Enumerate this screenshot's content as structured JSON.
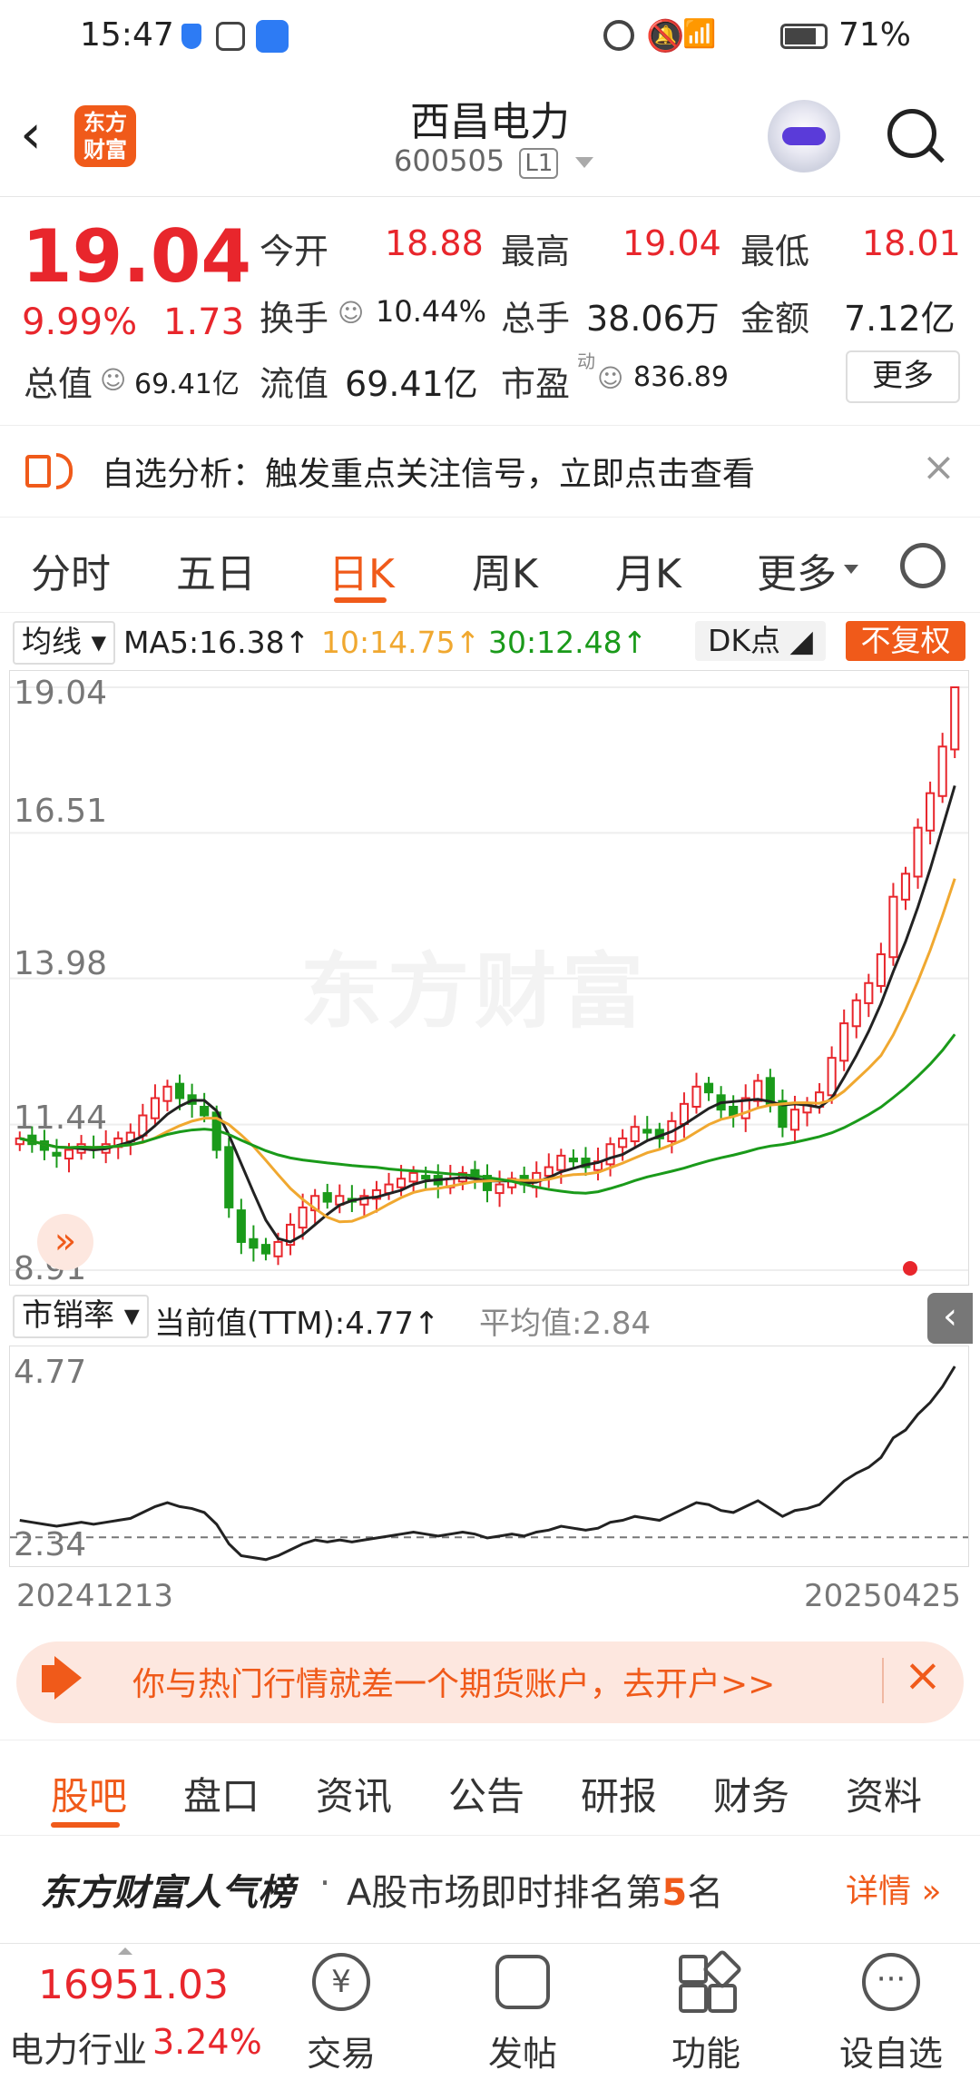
{
  "status_bar": {
    "time": "15:47",
    "battery": "71%"
  },
  "header": {
    "stock_name": "西昌电力",
    "stock_code": "600505",
    "level": "L1",
    "logo_text_1": "东方",
    "logo_text_2": "财富"
  },
  "quote": {
    "price": "19.04",
    "change_pct": "9.99%",
    "change": "1.73",
    "open_label": "今开",
    "open": "18.88",
    "high_label": "最高",
    "high": "19.04",
    "low_label": "最低",
    "low": "18.01",
    "turnover_label": "换手",
    "turnover": "10.44%",
    "volume_label": "总手",
    "volume": "38.06万",
    "amount_label": "金额",
    "amount": "7.12亿",
    "mktcap_label": "总值",
    "mktcap": "69.41亿",
    "float_label": "流值",
    "float": "69.41亿",
    "pe_label": "市盈",
    "pe_sup": "动",
    "pe": "836.89",
    "more_button": "更多"
  },
  "alert": {
    "text": "自选分析：触发重点关注信号，立即点击查看"
  },
  "chart_tabs": [
    "分时",
    "五日",
    "日K",
    "周K",
    "月K",
    "更多"
  ],
  "active_tab_index": 2,
  "ma_bar": {
    "selector": "均线",
    "ma5": "MA5:16.38↑",
    "ma10": "10:14.75↑",
    "ma30": "30:12.48↑",
    "dk": "DK点",
    "fq": "不复权"
  },
  "kline_axis": {
    "ticks": [
      "19.04",
      "16.51",
      "13.98",
      "11.44",
      "8.91"
    ]
  },
  "indicator_bar": {
    "selector": "市销率",
    "current": "当前值(TTM):4.77↑",
    "average": "平均值:2.84"
  },
  "indicator_axis": {
    "top": "4.77",
    "bottom": "2.34"
  },
  "date_range": {
    "start": "20241213",
    "end": "20250425"
  },
  "watermark": "东方财富",
  "promo": {
    "text": "你与热门行情就差一个期货账户，去开户>>"
  },
  "bottom_tabs": [
    "股吧",
    "盘口",
    "资讯",
    "公告",
    "研报",
    "财务",
    "资料"
  ],
  "ranking": {
    "brand": "东方财富人气榜",
    "dot": "·",
    "text_pre": "A股市场即时排名第",
    "rank": "5",
    "text_post": "名",
    "detail": "详情"
  },
  "footer": {
    "index_value": "16951.03",
    "index_name": "电力行业",
    "index_change": "3.24%",
    "items": [
      "交易",
      "发帖",
      "功能",
      "设自选"
    ]
  },
  "colors": {
    "up": "#e8262c",
    "down": "#1a9a1a",
    "accent": "#f05a1a",
    "ma5": "#222222",
    "ma10": "#f0a830",
    "ma30": "#1a9a1a"
  },
  "chart_data": {
    "type": "candlestick",
    "x_range": [
      "20241213",
      "20250425"
    ],
    "ylim": [
      8.91,
      19.04
    ],
    "ma_last": {
      "MA5": 16.38,
      "MA10": 14.75,
      "MA30": 12.48
    },
    "close_approx": [
      11.2,
      11.1,
      11.0,
      10.9,
      11.0,
      11.1,
      11.0,
      11.1,
      11.2,
      11.3,
      11.6,
      11.9,
      12.1,
      11.9,
      11.8,
      11.6,
      11.0,
      10.0,
      9.4,
      9.3,
      9.2,
      9.4,
      9.7,
      10.0,
      10.2,
      10.1,
      10.2,
      10.1,
      10.2,
      10.3,
      10.4,
      10.5,
      10.6,
      10.5,
      10.4,
      10.5,
      10.6,
      10.5,
      10.3,
      10.4,
      10.5,
      10.4,
      10.6,
      10.7,
      10.9,
      10.8,
      10.7,
      10.8,
      11.1,
      11.2,
      11.4,
      11.3,
      11.2,
      11.5,
      11.8,
      12.1,
      12.0,
      11.7,
      11.6,
      11.9,
      12.2,
      11.8,
      11.4,
      11.7,
      11.8,
      12.0,
      12.6,
      13.2,
      13.6,
      13.9,
      14.4,
      15.4,
      15.8,
      16.6,
      17.2,
      18.01,
      19.04
    ],
    "indicator": {
      "name": "市销率",
      "current": 4.77,
      "average": 2.84,
      "ylim": [
        2.34,
        4.77
      ]
    }
  }
}
